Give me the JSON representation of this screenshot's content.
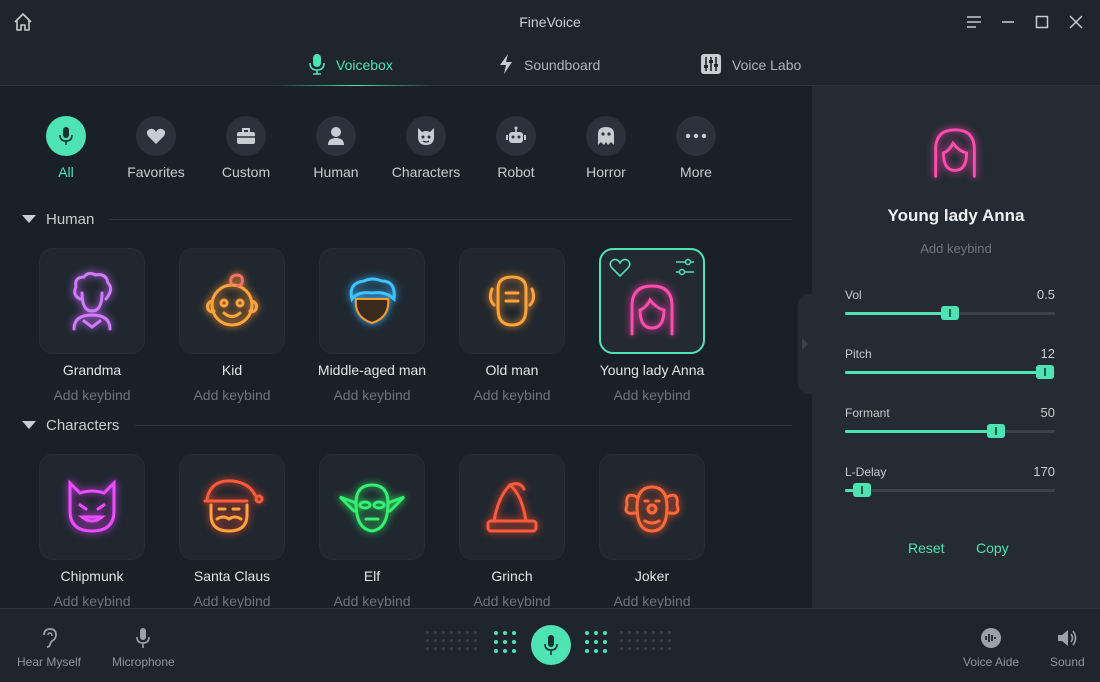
{
  "app": {
    "title": "FineVoice"
  },
  "tabs": [
    {
      "label": "Voicebox",
      "icon": "microphone-icon",
      "active": true
    },
    {
      "label": "Soundboard",
      "icon": "lightning-icon",
      "active": false
    },
    {
      "label": "Voice Labo",
      "icon": "equalizer-icon",
      "active": false
    }
  ],
  "categories": [
    {
      "label": "All",
      "icon": "microphone-icon",
      "active": true
    },
    {
      "label": "Favorites",
      "icon": "heart-icon"
    },
    {
      "label": "Custom",
      "icon": "briefcase-icon"
    },
    {
      "label": "Human",
      "icon": "person-icon"
    },
    {
      "label": "Characters",
      "icon": "cat-face-icon"
    },
    {
      "label": "Robot",
      "icon": "robot-icon"
    },
    {
      "label": "Horror",
      "icon": "ghost-icon"
    },
    {
      "label": "More",
      "icon": "more-dots-icon"
    }
  ],
  "sections": {
    "human": {
      "title": "Human",
      "voices": [
        {
          "name": "Grandma",
          "keybind": "Add keybind",
          "icon": "grandma-icon",
          "color": "#c86cff"
        },
        {
          "name": "Kid",
          "keybind": "Add keybind",
          "icon": "kid-icon",
          "color": "#ff9a2e"
        },
        {
          "name": "Middle-aged man",
          "keybind": "Add keybind",
          "icon": "middle-aged-man-icon",
          "color": "#37b8ff"
        },
        {
          "name": "Old man",
          "keybind": "Add keybind",
          "icon": "old-man-icon",
          "color": "#ff9a2e"
        },
        {
          "name": "Young lady Anna",
          "keybind": "Add keybind",
          "icon": "young-lady-icon",
          "color": "#ff3fa6",
          "selected": true
        }
      ]
    },
    "characters": {
      "title": "Characters",
      "voices": [
        {
          "name": "Chipmunk",
          "keybind": "Add keybind",
          "icon": "chipmunk-icon",
          "color": "#e33dff"
        },
        {
          "name": "Santa Claus",
          "keybind": "Add keybind",
          "icon": "santa-claus-icon",
          "color": "#ff4a2e"
        },
        {
          "name": "Elf",
          "keybind": "Add keybind",
          "icon": "elf-icon",
          "color": "#2ee86a"
        },
        {
          "name": "Grinch",
          "keybind": "Add keybind",
          "icon": "grinch-hat-icon",
          "color": "#ff4a2e"
        },
        {
          "name": "Joker",
          "keybind": "Add keybind",
          "icon": "joker-icon",
          "color": "#ff5a2e"
        }
      ]
    }
  },
  "selected_voice": {
    "name": "Young lady Anna",
    "keybind": "Add keybind",
    "sliders": [
      {
        "label": "Vol",
        "value": "0.5",
        "level": 0.5
      },
      {
        "label": "Pitch",
        "value": "12",
        "level": 0.95
      },
      {
        "label": "Formant",
        "value": "50",
        "level": 0.72
      },
      {
        "label": "L-Delay",
        "value": "170",
        "level": 0.08
      }
    ],
    "reset_label": "Reset",
    "copy_label": "Copy"
  },
  "bottom": {
    "hear_myself": "Hear Myself",
    "microphone": "Microphone",
    "voice_aide": "Voice Aide",
    "sound": "Sound"
  },
  "colors": {
    "accent": "#4ee3b3"
  }
}
